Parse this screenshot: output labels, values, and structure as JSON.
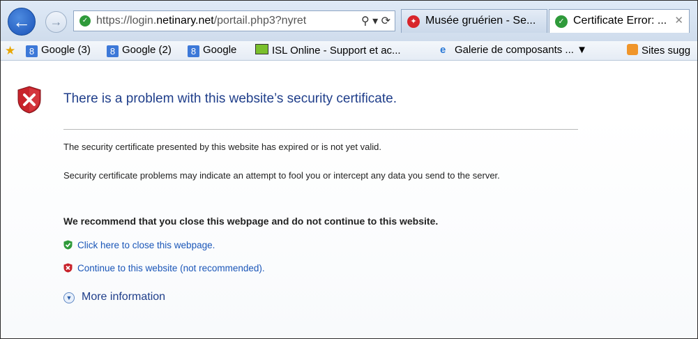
{
  "address_bar": {
    "url_prefix": "https://login.",
    "url_domain": "netinary.net",
    "url_rest": "/portail.php3?nyret",
    "search_glyph": "⚲",
    "dropdown_glyph": "▾",
    "refresh_glyph": "⟳"
  },
  "tabs": [
    {
      "title": "Musée gruérien - Se...",
      "icon": "red-bird-icon",
      "close": ""
    },
    {
      "title": "Certificate Error: ...",
      "icon": "green-shield-icon",
      "close": "✕"
    }
  ],
  "favorites": {
    "items": [
      {
        "label": "Google (3)",
        "icon": "google-icon"
      },
      {
        "label": "Google (2)",
        "icon": "google-icon"
      },
      {
        "label": "Google",
        "icon": "google-icon"
      },
      {
        "label": "ISL Online - Support et ac...",
        "icon": "monitor-icon"
      },
      {
        "label": "Galerie de composants ... ▼",
        "icon": "ie-icon"
      },
      {
        "label": "Sites sugg",
        "icon": "suggested-sites-icon"
      }
    ]
  },
  "page": {
    "heading": "There is a problem with this website’s security certificate.",
    "para1": "The security certificate presented by this website has expired or is not yet valid.",
    "para2": "Security certificate problems may indicate an attempt to fool you or intercept any data you send to the server.",
    "recommend": "We recommend that you close this webpage and do not continue to this website.",
    "close_link": "Click here to close this webpage.",
    "continue_link": "Continue to this website (not recommended).",
    "more_info": "More information"
  },
  "colors": {
    "link": "#1a56b8",
    "heading": "#1f3e8a",
    "shield_red": "#c8232b",
    "ok_green": "#2f9a3a"
  }
}
